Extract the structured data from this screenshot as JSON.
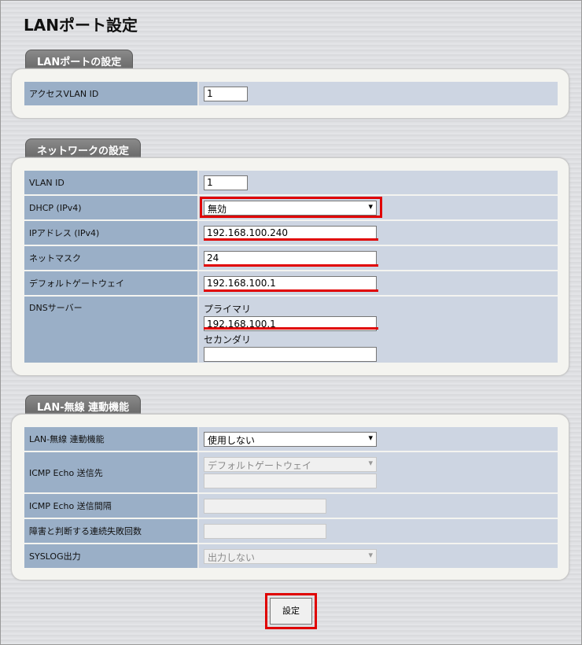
{
  "page_title": "LANポート設定",
  "sections": {
    "lan_port": {
      "tab": "LANポートの設定",
      "rows": {
        "access_vlan_id": {
          "label": "アクセスVLAN ID",
          "value": "1"
        }
      }
    },
    "network": {
      "tab": "ネットワークの設定",
      "rows": {
        "vlan_id": {
          "label": "VLAN ID",
          "value": "1"
        },
        "dhcp": {
          "label": "DHCP (IPv4)",
          "value": "無効"
        },
        "ip_address": {
          "label": "IPアドレス (IPv4)",
          "value": "192.168.100.240"
        },
        "netmask": {
          "label": "ネットマスク",
          "value": "24"
        },
        "gateway": {
          "label": "デフォルトゲートウェイ",
          "value": "192.168.100.1"
        },
        "dns": {
          "label": "DNSサーバー",
          "primary_label": "プライマリ",
          "primary_value": "192.168.100.1",
          "secondary_label": "セカンダリ",
          "secondary_value": ""
        }
      }
    },
    "lan_wireless": {
      "tab": "LAN-無線 連動機能",
      "rows": {
        "link_function": {
          "label": "LAN-無線 連動機能",
          "value": "使用しない"
        },
        "icmp_dest": {
          "label": "ICMP Echo 送信先",
          "value": "デフォルトゲートウェイ",
          "extra_value": ""
        },
        "icmp_interval": {
          "label": "ICMP Echo 送信間隔",
          "value": ""
        },
        "fail_count": {
          "label": "障害と判断する連続失敗回数",
          "value": ""
        },
        "syslog": {
          "label": "SYSLOG出力",
          "value": "出力しない"
        }
      }
    }
  },
  "submit_label": "設定",
  "highlight_color": "#e00000"
}
